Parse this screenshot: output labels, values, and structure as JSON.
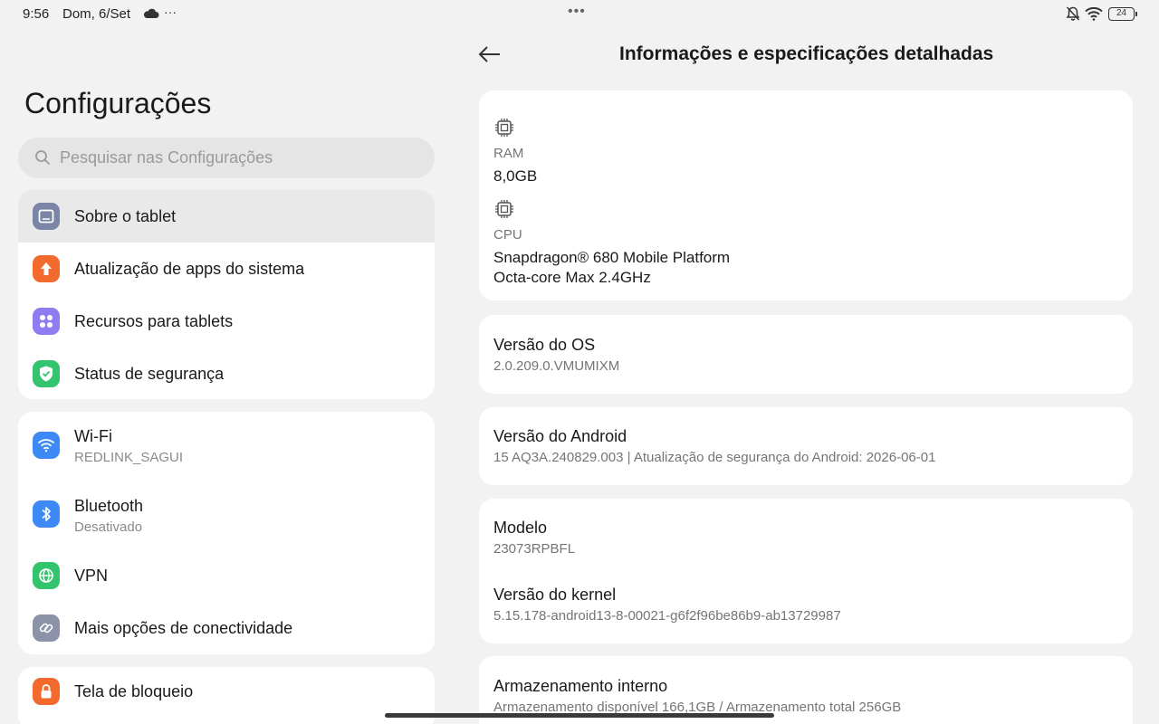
{
  "status_bar": {
    "time": "9:56",
    "date": "Dom, 6/Set",
    "more": "···",
    "center_dots": "•••",
    "battery": "24"
  },
  "settings": {
    "title": "Configurações",
    "search_placeholder": "Pesquisar nas Configurações",
    "group1": [
      {
        "label": "Sobre o tablet",
        "icon": "tablet-icon",
        "color": "#7b86a6"
      },
      {
        "label": "Atualização de apps do sistema",
        "icon": "arrow-up-icon",
        "color": "#f26a2e"
      },
      {
        "label": "Recursos para tablets",
        "icon": "grid-dots-icon",
        "color": "#8f7cf0"
      },
      {
        "label": "Status de segurança",
        "icon": "shield-check-icon",
        "color": "#35c46e"
      }
    ],
    "group2": [
      {
        "label": "Wi-Fi",
        "sub": "REDLINK_SAGUI",
        "icon": "wifi-icon",
        "color": "#3d8af7"
      },
      {
        "label": "Bluetooth",
        "sub": "Desativado",
        "icon": "bluetooth-icon",
        "color": "#3d8af7"
      },
      {
        "label": "VPN",
        "icon": "globe-icon",
        "color": "#35c46e"
      },
      {
        "label": "Mais opções de conectividade",
        "icon": "link-icon",
        "color": "#8c93a8"
      }
    ],
    "group3": [
      {
        "label": "Tela de bloqueio",
        "icon": "lock-icon",
        "color": "#f26a2e"
      }
    ]
  },
  "detail": {
    "title": "Informações e especificações detalhadas",
    "ram": {
      "label": "RAM",
      "value": "8,0GB"
    },
    "cpu": {
      "label": "CPU",
      "value_line1": "Snapdragon® 680 Mobile Platform",
      "value_line2": "Octa-core Max 2.4GHz"
    },
    "os_version": {
      "title": "Versão do OS",
      "value": "2.0.209.0.VMUMIXM"
    },
    "android_version": {
      "title": "Versão do Android",
      "value": "15 AQ3A.240829.003 | Atualização de segurança do Android: 2026-06-01"
    },
    "model": {
      "title": "Modelo",
      "value": "23073RPBFL"
    },
    "kernel": {
      "title": "Versão do kernel",
      "value": "5.15.178-android13-8-00021-g6f2f96be86b9-ab13729987"
    },
    "storage": {
      "title": "Armazenamento interno",
      "value": "Armazenamento disponível 166,1GB / Armazenamento total 256GB"
    }
  }
}
